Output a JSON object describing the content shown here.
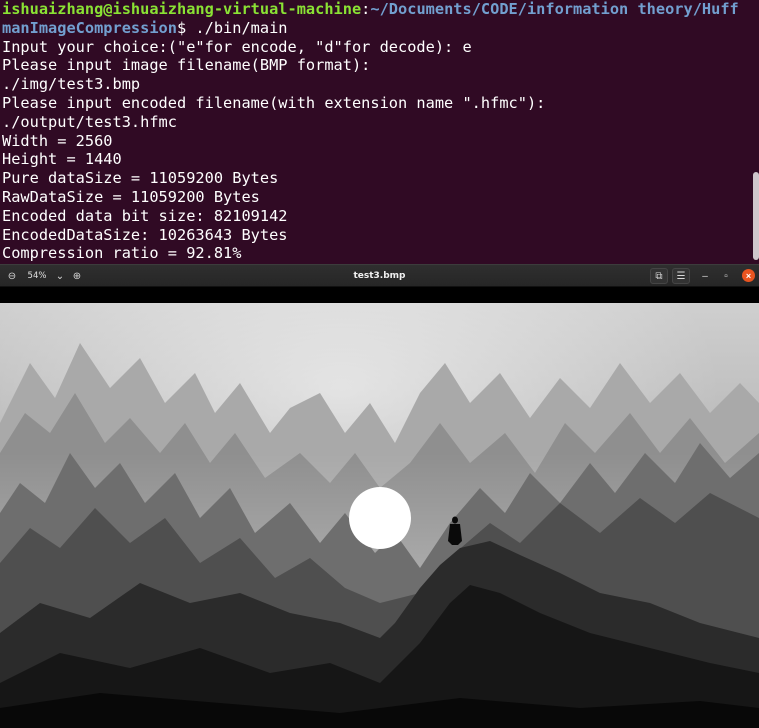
{
  "terminal": {
    "prompt_line_1": {
      "user_host": "ishuaizhang@ishuaizhang-virtual-machine",
      "colon": ":",
      "path_part1": "~/Documents/CODE/information theory/Huff"
    },
    "prompt_line_2": {
      "path_part2": "manImageCompression",
      "prompt_symbol": "$ ",
      "command": "./bin/main"
    },
    "output_lines": [
      "Input your choice:(\"e\"for encode, \"d\"for decode): e",
      "Please input image filename(BMP format):",
      "./img/test3.bmp",
      "Please input encoded filename(with extension name \".hfmc\"):",
      "./output/test3.hfmc",
      "Width = 2560",
      "Height = 1440",
      "Pure dataSize = 11059200 Bytes",
      "RawDataSize = 11059200 Bytes",
      "Encoded data bit size: 82109142",
      "EncodedDataSize: 10263643 Bytes",
      "Compression ratio = 92.81%"
    ],
    "colors": {
      "background": "#300a24",
      "text": "#ffffff",
      "user": "#8ae234",
      "path": "#729fcf"
    }
  },
  "viewer": {
    "title": "test3.bmp",
    "zoom_level": "54%",
    "icons": {
      "zoom_out": "zoom-out-icon",
      "zoom_menu": "chevron-down-icon",
      "zoom_in": "zoom-in-icon",
      "slideshow": "slideshow-icon",
      "menu": "hamburger-menu-icon",
      "minimize": "minimize-icon",
      "maximize": "maximize-icon",
      "close": "close-icon"
    },
    "glyphs": {
      "zoom_out": "⊖",
      "zoom_menu": "⌄",
      "zoom_in": "⊕",
      "slideshow": "⧉",
      "menu": "☰",
      "minimize": "–",
      "maximize": "▫",
      "close": "×"
    },
    "accent_close": "#e95420"
  }
}
